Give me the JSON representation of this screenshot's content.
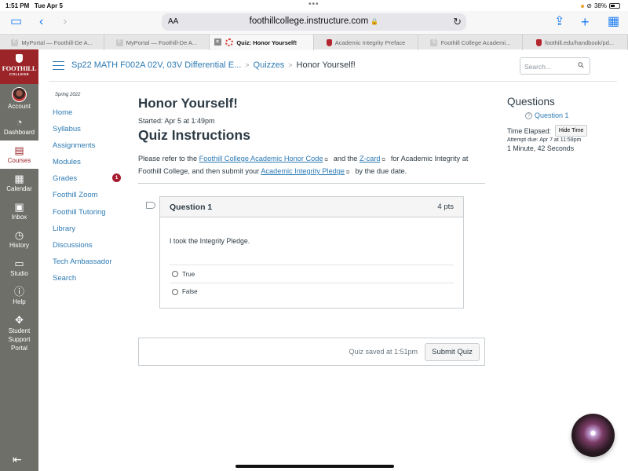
{
  "status_bar": {
    "time": "1:51 PM",
    "date": "Tue Apr 5",
    "battery": "38%",
    "battery_level": 0.38
  },
  "browser": {
    "text_size_label": "AA",
    "url": "foothillcollege.instructure.com",
    "tabs": [
      {
        "label": "MyPortal — Foothill-De A...",
        "favicon": "F",
        "active": false
      },
      {
        "label": "MyPortal — Foothill-De A...",
        "favicon": "F",
        "active": false
      },
      {
        "label": "Quiz: Honor Yourself!",
        "favicon": "canvas",
        "active": true
      },
      {
        "label": "Academic Integrity Preface",
        "favicon": "shield",
        "active": false
      },
      {
        "label": "Foothill College Academi...",
        "favicon": "S",
        "active": false
      },
      {
        "label": "foothill.edu/handbook/pd...",
        "favicon": "shield",
        "active": false
      }
    ]
  },
  "global_nav": {
    "logo": {
      "name": "FOOTHILL",
      "sub": "COLLEGE"
    },
    "items": [
      {
        "label": "Account",
        "icon": "avatar",
        "active": false
      },
      {
        "label": "Dashboard",
        "icon": "dashboard-icon",
        "active": false
      },
      {
        "label": "Courses",
        "icon": "book-icon",
        "active": true
      },
      {
        "label": "Calendar",
        "icon": "calendar-icon",
        "active": false
      },
      {
        "label": "Inbox",
        "icon": "inbox-icon",
        "active": false
      },
      {
        "label": "History",
        "icon": "clock-icon",
        "active": false
      },
      {
        "label": "Studio",
        "icon": "studio-icon",
        "active": false
      },
      {
        "label": "Help",
        "icon": "help-icon",
        "active": false
      },
      {
        "label": "Student Support Portal",
        "icon": "lifebuoy-icon",
        "active": false
      }
    ]
  },
  "breadcrumb": {
    "course": "Sp22 MATH F002A 02V, 03V Differential E...",
    "section": "Quizzes",
    "current": "Honor Yourself!",
    "separator": ">"
  },
  "search": {
    "placeholder": "Search..."
  },
  "course_nav": {
    "term": "Spring 2022",
    "items": [
      {
        "label": "Home"
      },
      {
        "label": "Syllabus"
      },
      {
        "label": "Assignments"
      },
      {
        "label": "Modules"
      },
      {
        "label": "Grades",
        "badge": "1"
      },
      {
        "label": "Foothill Zoom"
      },
      {
        "label": "Foothill Tutoring"
      },
      {
        "label": "Library"
      },
      {
        "label": "Discussions"
      },
      {
        "label": "Tech Ambassador"
      },
      {
        "label": "Search"
      }
    ]
  },
  "quiz": {
    "title": "Honor Yourself!",
    "started": "Started: Apr 5 at 1:49pm",
    "instructions_title": "Quiz Instructions",
    "instructions": {
      "t1": "Please refer to the ",
      "link1": "Foothill College Academic Honor Code",
      "t2": "and the ",
      "link2": "Z-card",
      "t3": "for Academic Integrity at Foothill College, and then submit your ",
      "link3": "Academic Integrity Pledge",
      "t4": "by the due date."
    },
    "question": {
      "title": "Question 1",
      "points": "4 pts",
      "text": "I took the Integrity Pledge.",
      "options": [
        {
          "label": "True",
          "selected": false
        },
        {
          "label": "False",
          "selected": false
        }
      ]
    },
    "saved_text": "Quiz saved at 1:51pm",
    "submit_label": "Submit Quiz"
  },
  "sidebar": {
    "title": "Questions",
    "question_link": "Question 1",
    "time_label": "Time Elapsed:",
    "hide_time_label": "Hide Time",
    "attempt_due": "Attempt due: Apr 7 at 11:59pm",
    "elapsed": "1 Minute, 42 Seconds"
  }
}
